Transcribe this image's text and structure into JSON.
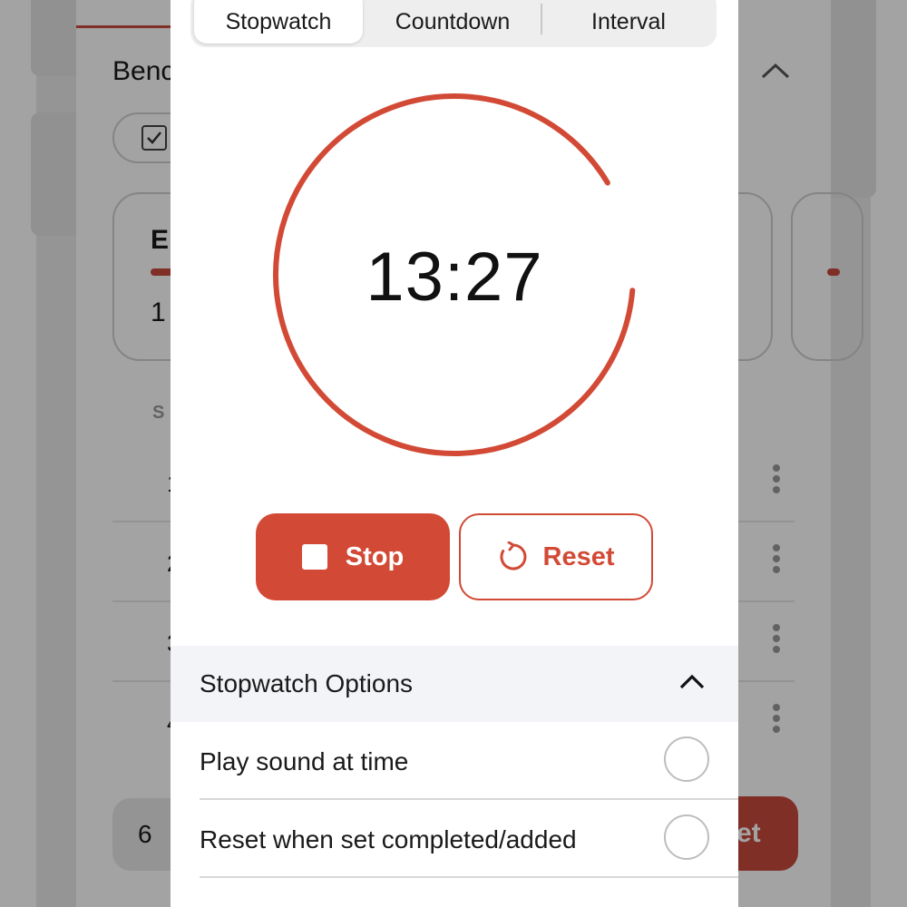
{
  "colors": {
    "accent": "#d24a36",
    "scrim": "rgba(0,0,0,0.36)",
    "options_bg": "#f2f4f7"
  },
  "background": {
    "title": "Benc",
    "stat_letter": "E",
    "stat_value": "1",
    "section_label": "S",
    "rows": [
      {
        "num": "1"
      },
      {
        "num": "2"
      },
      {
        "num": "3"
      },
      {
        "num": "4"
      }
    ],
    "count": "6",
    "add_label": "et"
  },
  "tabs": [
    {
      "label": "Stopwatch",
      "active": true
    },
    {
      "label": "Countdown",
      "active": false
    },
    {
      "label": "Interval",
      "active": false
    }
  ],
  "timer": {
    "display": "13:27",
    "progress": 0.9
  },
  "controls": {
    "stop_label": "Stop",
    "reset_label": "Reset"
  },
  "options": {
    "title": "Stopwatch Options",
    "items": [
      {
        "label": "Play sound at time",
        "checked": false
      },
      {
        "label": "Reset when set completed/added",
        "checked": false
      }
    ]
  },
  "icons": {
    "stop": "stop-square-icon",
    "reset": "reset-arrow-icon",
    "collapse": "chevron-up-icon",
    "more": "kebab-menu-icon",
    "checkbox": "checkbox-checked-icon"
  }
}
